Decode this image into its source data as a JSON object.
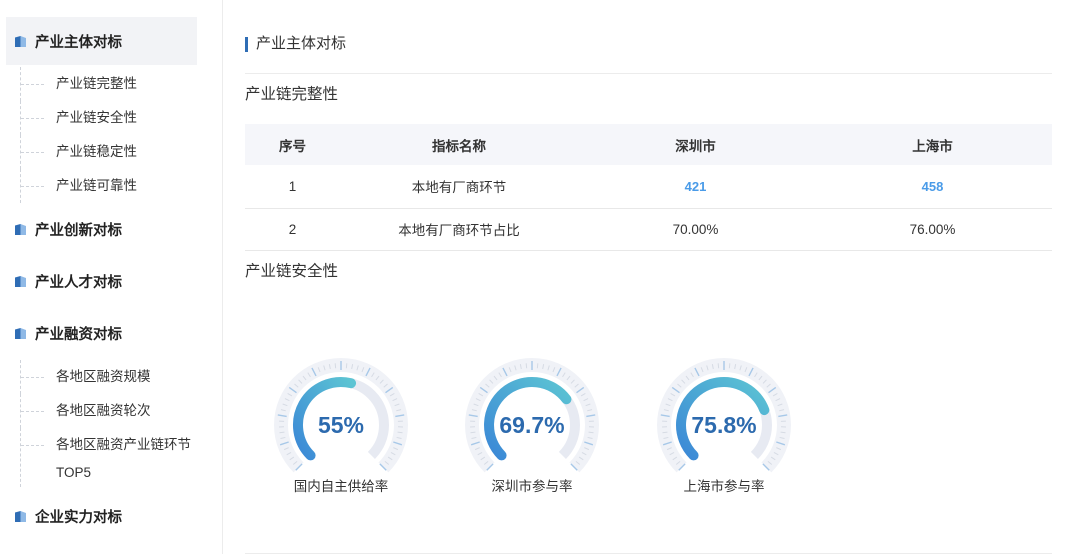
{
  "sidebar": {
    "groups": [
      {
        "label": "产业主体对标",
        "icon": "book-icon",
        "active": true,
        "children": [
          "产业链完整性",
          "产业链安全性",
          "产业链稳定性",
          "产业链可靠性"
        ]
      },
      {
        "label": "产业创新对标",
        "icon": "book-icon",
        "active": false,
        "children": []
      },
      {
        "label": "产业人才对标",
        "icon": "book-icon",
        "active": false,
        "children": []
      },
      {
        "label": "产业融资对标",
        "icon": "book-icon",
        "active": false,
        "children": [
          "各地区融资规模",
          "各地区融资轮次",
          "各地区融资产业链环节TOP5"
        ]
      },
      {
        "label": "企业实力对标",
        "icon": "book-icon",
        "active": false,
        "children": []
      }
    ]
  },
  "main": {
    "section_title": "产业主体对标",
    "completeness": {
      "title": "产业链完整性",
      "columns": [
        "序号",
        "指标名称",
        "深圳市",
        "上海市"
      ],
      "rows": [
        [
          "1",
          "本地有厂商环节",
          "421",
          "458"
        ],
        [
          "2",
          "本地有厂商环节占比",
          "70.00%",
          "76.00%"
        ]
      ]
    },
    "security": {
      "title": "产业链安全性",
      "gauge_range": [
        0,
        100
      ],
      "gauges": [
        {
          "label": "国内自主供给率",
          "value": 55,
          "display": "55%"
        },
        {
          "label": "深圳市参与率",
          "value": 69.7,
          "display": "69.7%"
        },
        {
          "label": "上海市参与率",
          "value": 75.8,
          "display": "75.8%"
        }
      ]
    }
  },
  "theme": {
    "accent": "#2f6db5",
    "text": "#333333",
    "link_number": "#4a9be8",
    "gauge_value": "#2c6aae",
    "gauge_gradient_start": "#3b88d6",
    "gauge_gradient_end": "#5cc4d3",
    "gauge_track": "#e7eaf2",
    "gauge_outer_band": "#f0f2f7",
    "gauge_minor_tick": "#d6dbe4",
    "gauge_major_tick": "#a7c8e8",
    "table_header_bg": "#f5f6fa",
    "active_nav_bg": "#f2f3f6"
  }
}
